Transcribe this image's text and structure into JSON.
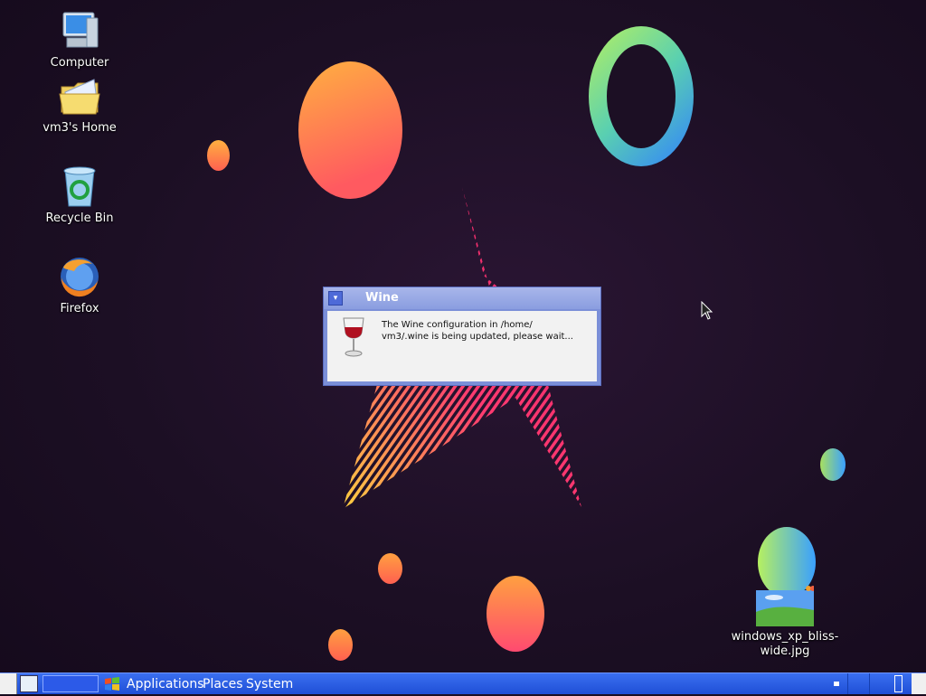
{
  "desktop": {
    "icons": [
      {
        "label": "Computer",
        "icon": "computer-icon"
      },
      {
        "label": "vm3's Home",
        "icon": "home-folder-icon"
      },
      {
        "label": "Recycle Bin",
        "icon": "recycle-bin-icon"
      },
      {
        "label": "Firefox",
        "icon": "firefox-icon"
      },
      {
        "label": "windows_xp_bliss-\nwide.jpg",
        "icon": "image-file-icon"
      }
    ]
  },
  "dialog": {
    "title": "Wine",
    "message": "The Wine configuration in /home/\nvm3/.wine is being updated, please wait..."
  },
  "taskbar": {
    "menus": [
      "Applications",
      "Places",
      "System"
    ]
  },
  "colors": {
    "taskbar": "#1f4fd6",
    "dialog_frame": "#7b8fd8",
    "desktop_bg": "#1c0f24"
  }
}
